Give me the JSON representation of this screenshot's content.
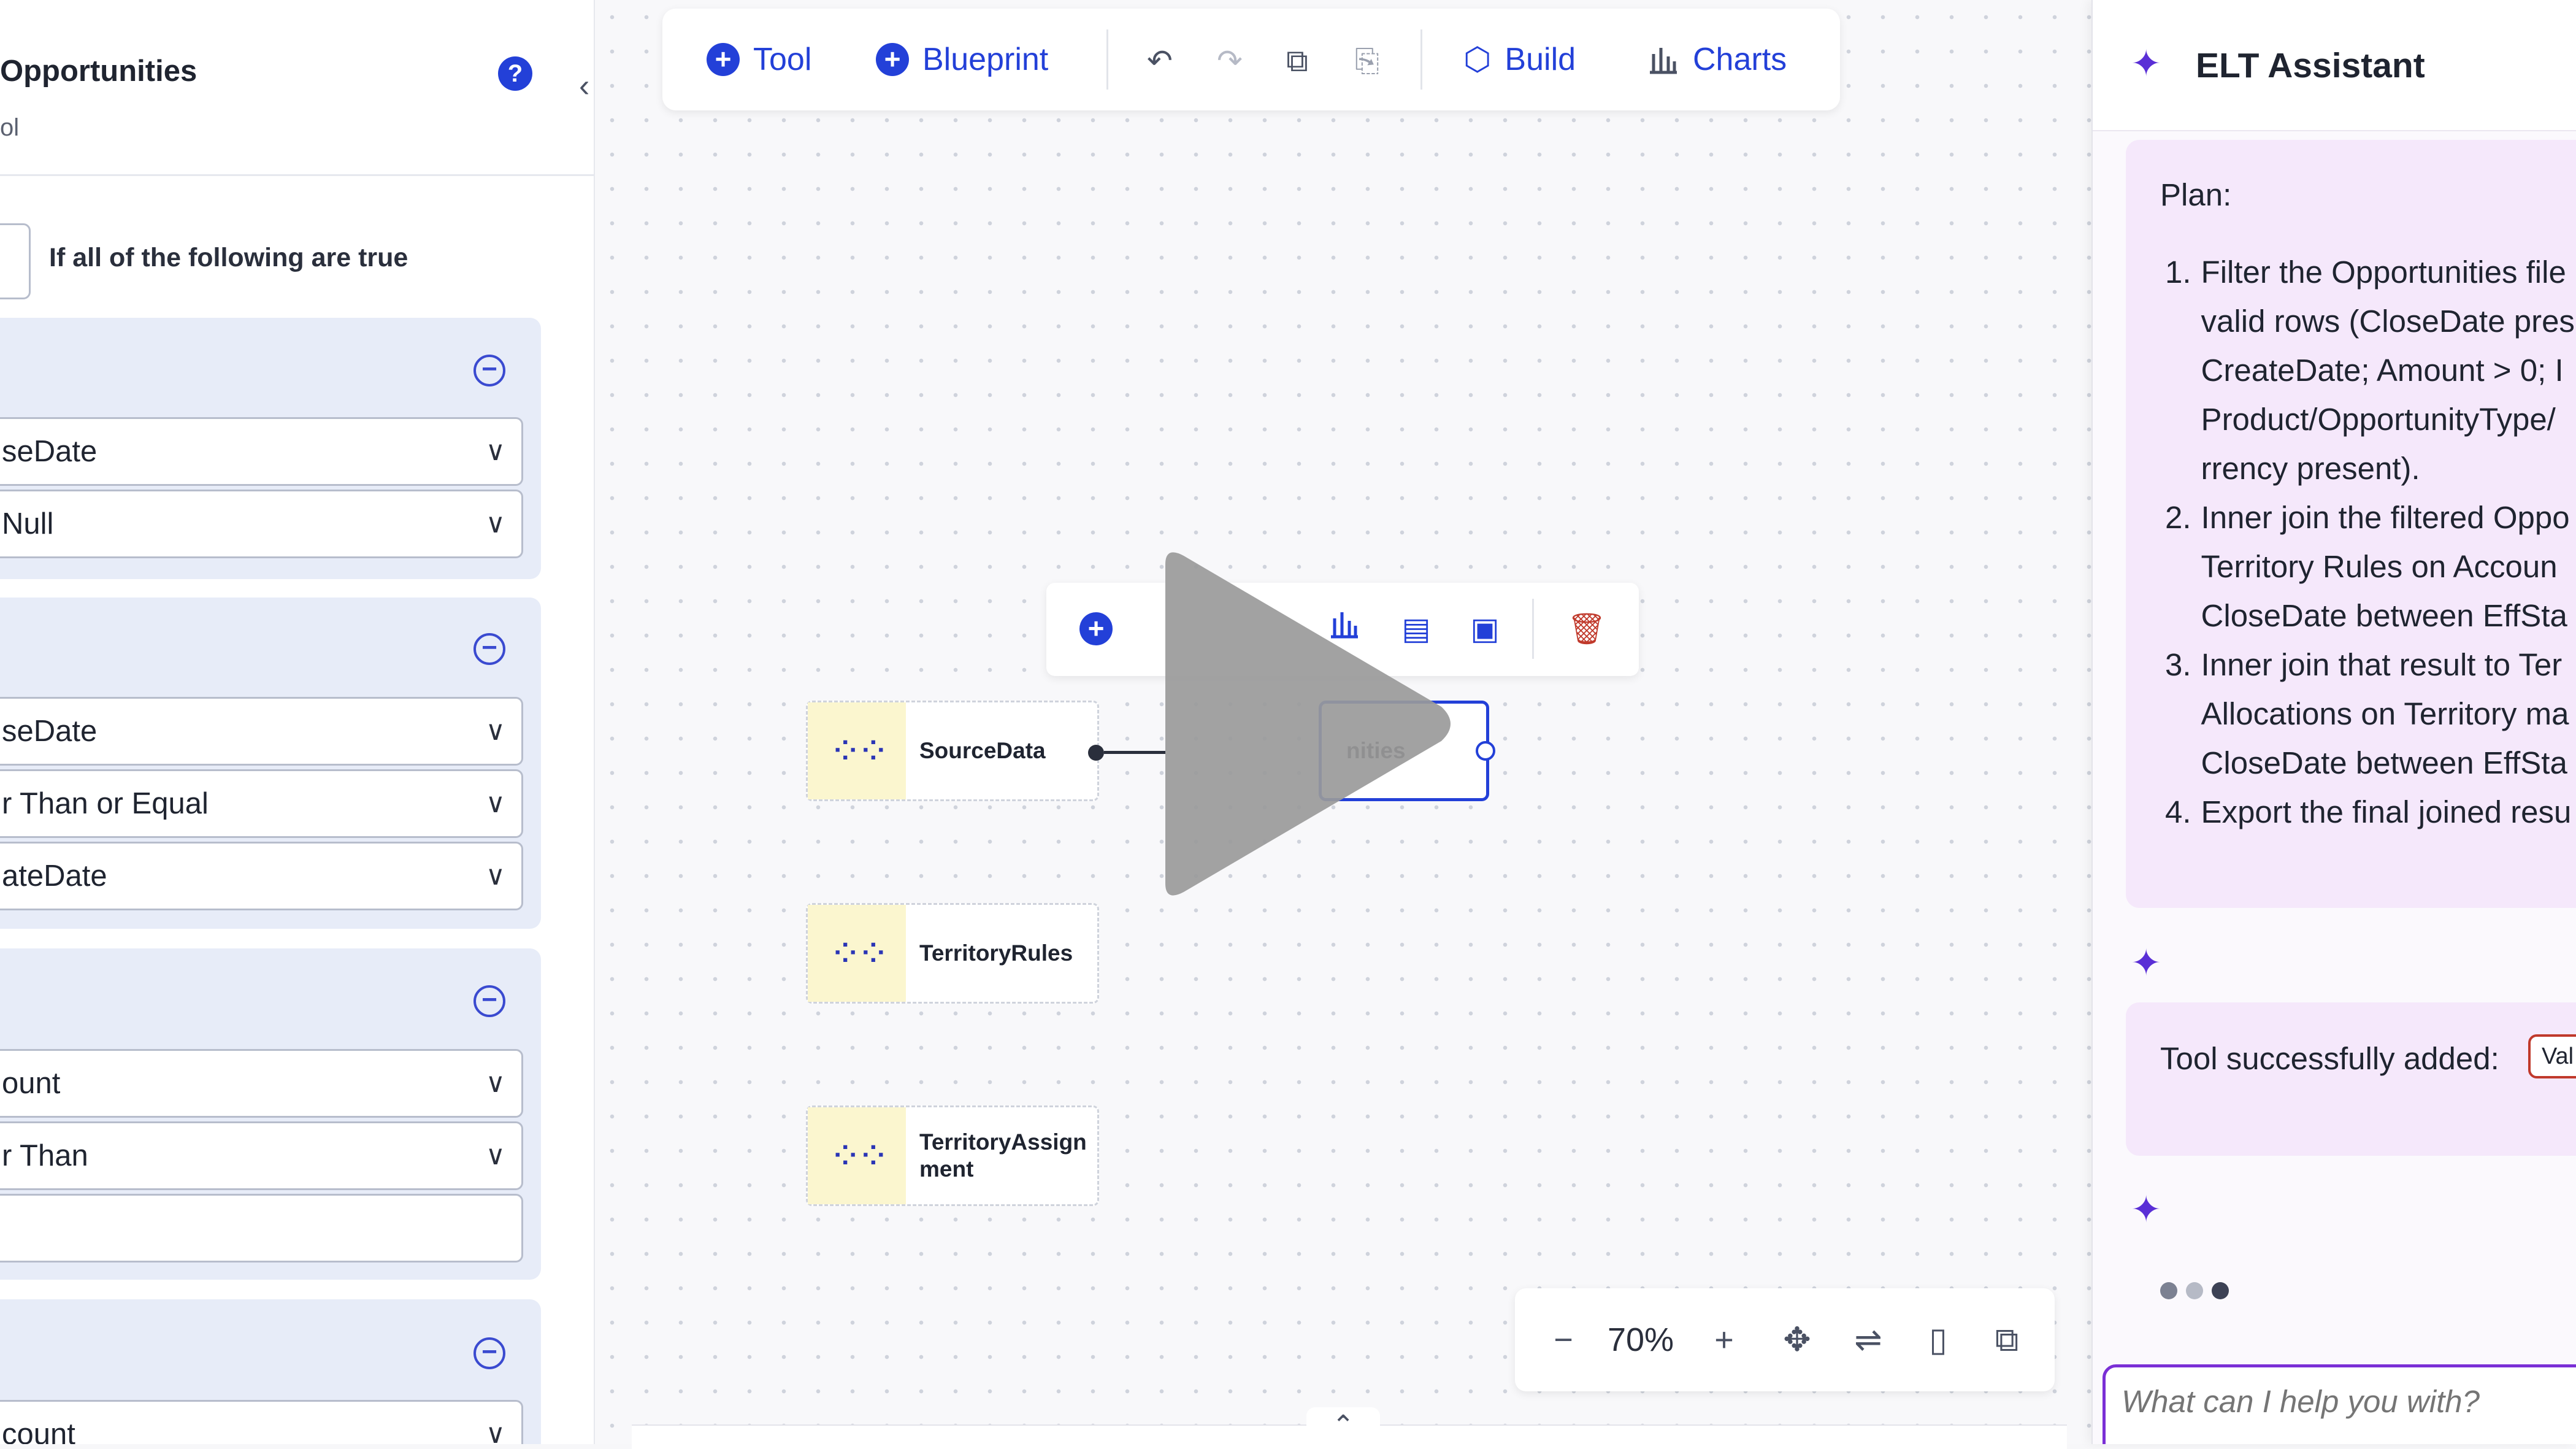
{
  "left_panel": {
    "title": "Opportunities",
    "subtitle": "ol",
    "condition_text": "If all of the following are true",
    "rules": [
      {
        "fields": [
          "seDate",
          "Null"
        ]
      },
      {
        "fields": [
          "seDate",
          "r Than or Equal",
          "ateDate"
        ]
      },
      {
        "fields": [
          "ount",
          "r Than",
          ""
        ]
      },
      {
        "fields": [
          "count"
        ]
      }
    ]
  },
  "toolbar": {
    "tool_label": "Tool",
    "blueprint_label": "Blueprint",
    "build_label": "Build",
    "charts_label": "Charts"
  },
  "canvas": {
    "nodes": [
      {
        "label": "SourceData"
      },
      {
        "label": "TerritoryRules"
      },
      {
        "label": "TerritoryAssignment"
      }
    ],
    "selected_node_label": "nities"
  },
  "zoom": {
    "minus": "−",
    "level": "70%",
    "plus": "+"
  },
  "assistant": {
    "title": "ELT Assistant",
    "plan_heading": "Plan:",
    "plan_items": [
      {
        "num": "1.",
        "lines": [
          "Filter the Opportunities file",
          "valid rows (CloseDate pres",
          "CreateDate; Amount > 0; I",
          "Product/OpportunityType/",
          "rrency present)."
        ]
      },
      {
        "num": "2.",
        "lines": [
          "Inner join the filtered Oppo",
          "Territory Rules on Accoun",
          "CloseDate between EffSta"
        ]
      },
      {
        "num": "3.",
        "lines": [
          "Inner join that result to Ter",
          "Allocations on Territory ma",
          "CloseDate between EffSta"
        ]
      },
      {
        "num": "4.",
        "lines": [
          "Export the final joined resu"
        ]
      }
    ],
    "tool_added_text": "Tool successfully added:",
    "tool_tag": "Val",
    "input_placeholder": "What can I help you with?"
  },
  "colors": {
    "accent": "#2340d8",
    "assistant_bubble": "#f5e8fb",
    "node_icon_bg": "#fbf6cf",
    "delete_red": "#c0392b"
  }
}
